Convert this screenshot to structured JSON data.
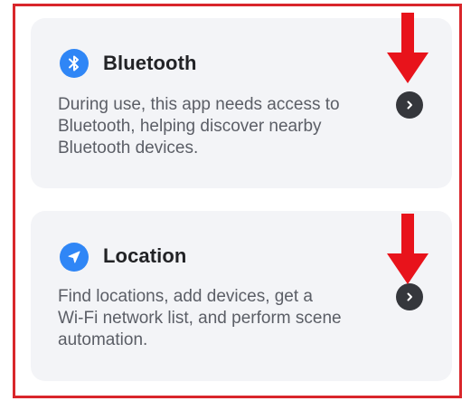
{
  "colors": {
    "frame": "#d9262b",
    "card": "#f3f4f7",
    "icon_bg": "#2f86f6",
    "chevron_bg": "#35373c",
    "arrow": "#e8131b"
  },
  "permissions": [
    {
      "title": "Bluetooth",
      "icon": "bluetooth-icon",
      "description_lines": [
        "During use, this app needs access to",
        "Bluetooth, helping discover nearby",
        "Bluetooth devices."
      ]
    },
    {
      "title": "Location",
      "icon": "location-arrow-icon",
      "description_lines": [
        "Find locations, add devices, get a",
        "Wi-Fi network list, and perform scene",
        "automation."
      ]
    }
  ]
}
